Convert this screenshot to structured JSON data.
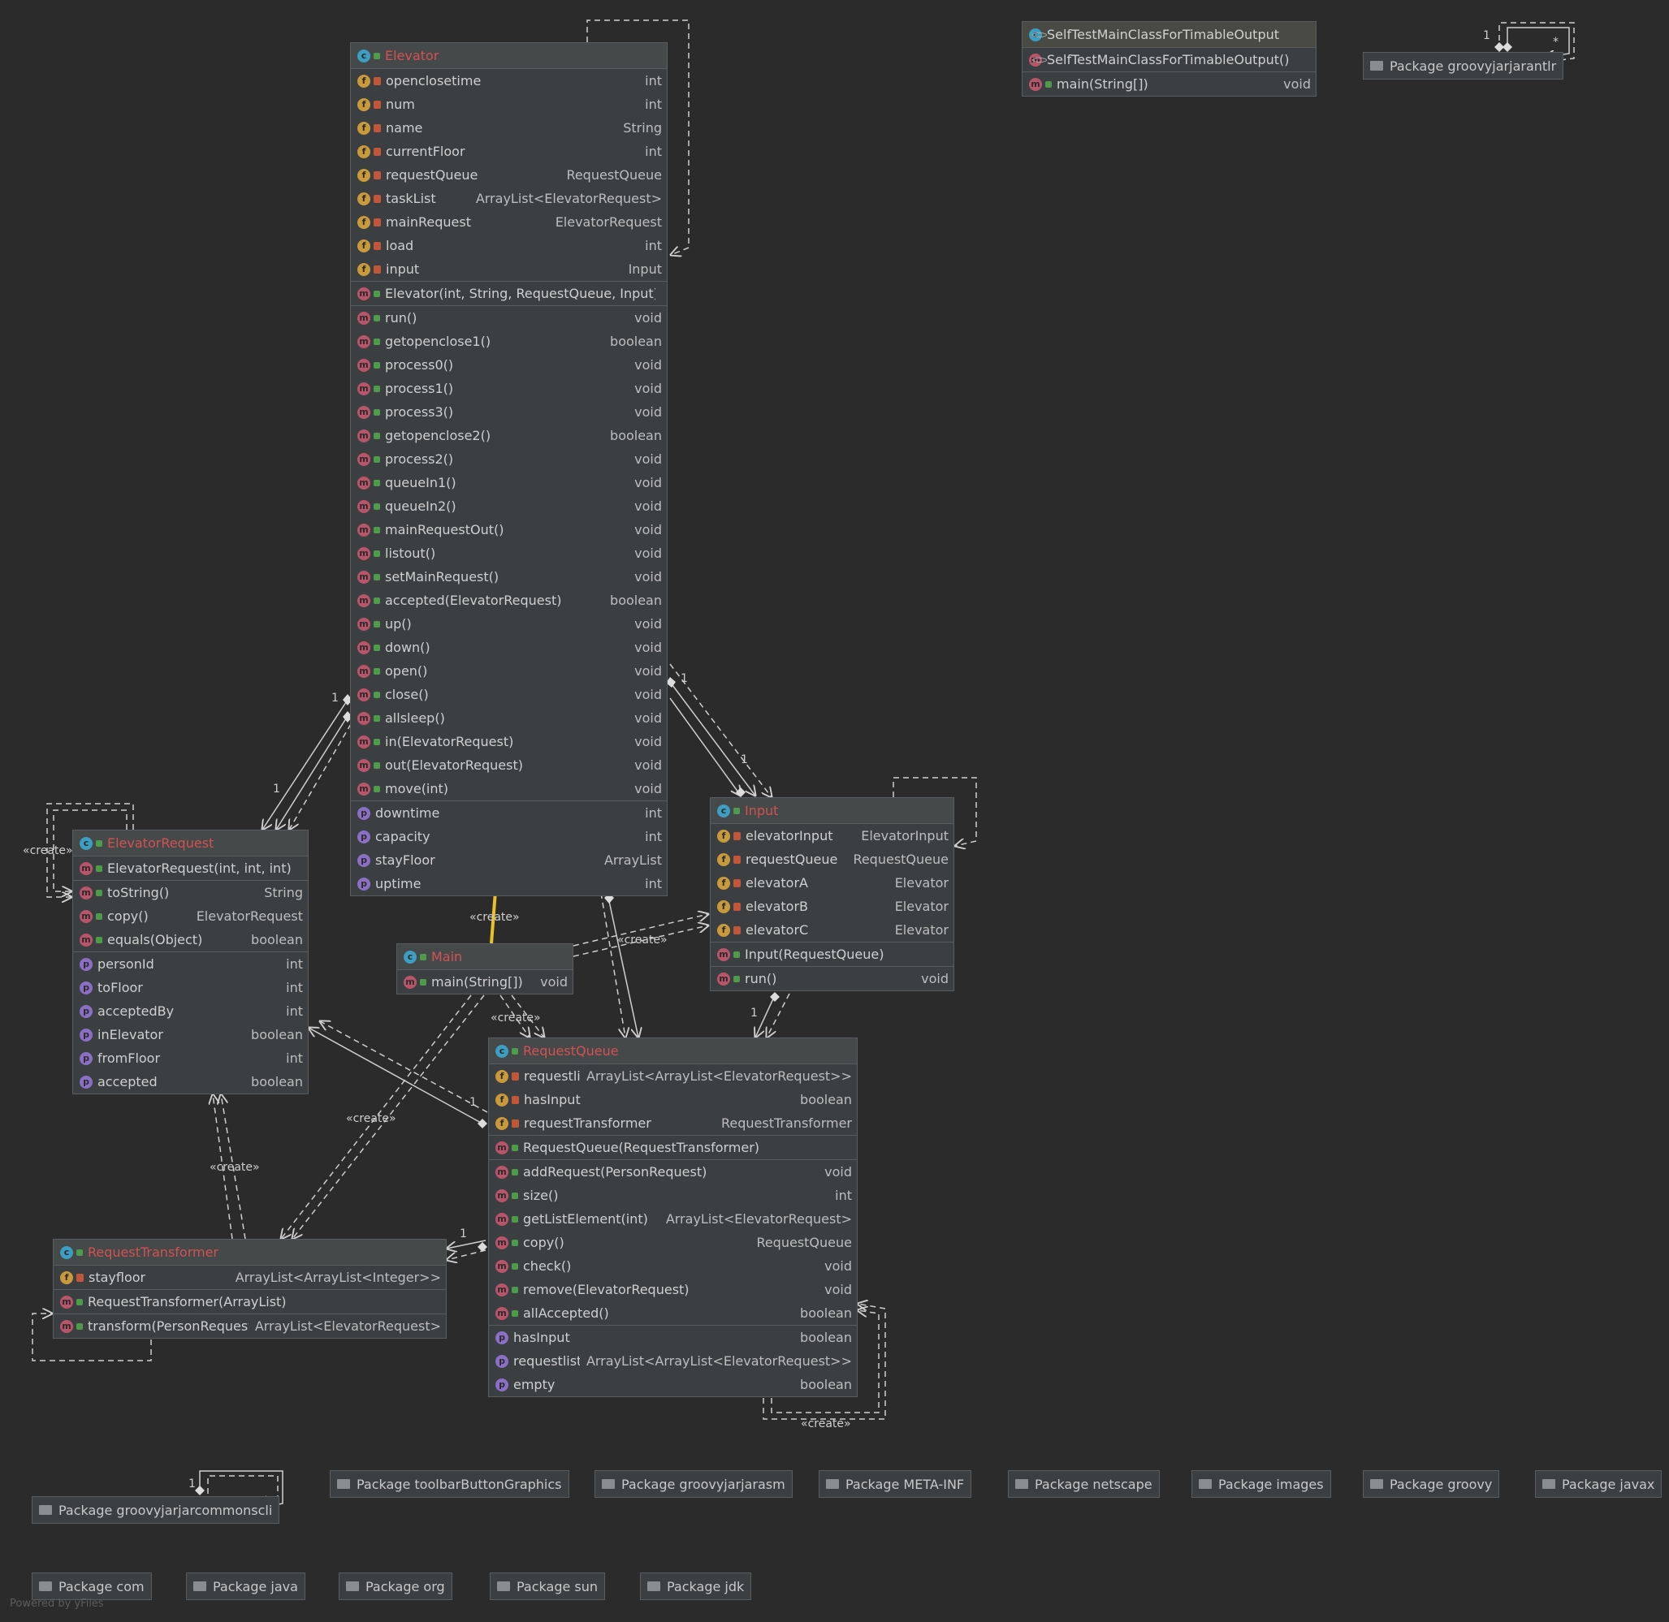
{
  "classes": {
    "elevator": {
      "name": "Elevator",
      "fields": [
        {
          "name": "openclosetime",
          "type": "int"
        },
        {
          "name": "num",
          "type": "int"
        },
        {
          "name": "name",
          "type": "String"
        },
        {
          "name": "currentFloor",
          "type": "int"
        },
        {
          "name": "requestQueue",
          "type": "RequestQueue"
        },
        {
          "name": "taskList",
          "type": "ArrayList<ElevatorRequest>"
        },
        {
          "name": "mainRequest",
          "type": "ElevatorRequest"
        },
        {
          "name": "load",
          "type": "int"
        },
        {
          "name": "input",
          "type": "Input"
        }
      ],
      "constructors": [
        {
          "name": "Elevator(int, String, RequestQueue, Input)",
          "type": ""
        }
      ],
      "methods": [
        {
          "name": "run()",
          "type": "void"
        },
        {
          "name": "getopenclose1()",
          "type": "boolean"
        },
        {
          "name": "process0()",
          "type": "void"
        },
        {
          "name": "process1()",
          "type": "void"
        },
        {
          "name": "process3()",
          "type": "void"
        },
        {
          "name": "getopenclose2()",
          "type": "boolean"
        },
        {
          "name": "process2()",
          "type": "void"
        },
        {
          "name": "queueIn1()",
          "type": "void"
        },
        {
          "name": "queueIn2()",
          "type": "void"
        },
        {
          "name": "mainRequestOut()",
          "type": "void"
        },
        {
          "name": "listout()",
          "type": "void"
        },
        {
          "name": "setMainRequest()",
          "type": "void"
        },
        {
          "name": "accepted(ElevatorRequest)",
          "type": "boolean"
        },
        {
          "name": "up()",
          "type": "void"
        },
        {
          "name": "down()",
          "type": "void"
        },
        {
          "name": "open()",
          "type": "void"
        },
        {
          "name": "close()",
          "type": "void"
        },
        {
          "name": "allsleep()",
          "type": "void"
        },
        {
          "name": "in(ElevatorRequest)",
          "type": "void"
        },
        {
          "name": "out(ElevatorRequest)",
          "type": "void"
        },
        {
          "name": "move(int)",
          "type": "void"
        }
      ],
      "properties": [
        {
          "name": "downtime",
          "type": "int"
        },
        {
          "name": "capacity",
          "type": "int"
        },
        {
          "name": "stayFloor",
          "type": "ArrayList"
        },
        {
          "name": "uptime",
          "type": "int"
        }
      ]
    },
    "selftest": {
      "name": "SelfTestMainClassForTimableOutput",
      "constructors": [
        {
          "name": "SelfTestMainClassForTimableOutput()",
          "type": ""
        }
      ],
      "methods": [
        {
          "name": "main(String[])",
          "type": "void"
        }
      ]
    },
    "elevatorRequest": {
      "name": "ElevatorRequest",
      "constructors": [
        {
          "name": "ElevatorRequest(int, int, int)",
          "type": ""
        }
      ],
      "methods": [
        {
          "name": "toString()",
          "type": "String"
        },
        {
          "name": "copy()",
          "type": "ElevatorRequest"
        },
        {
          "name": "equals(Object)",
          "type": "boolean"
        }
      ],
      "properties": [
        {
          "name": "personId",
          "type": "int"
        },
        {
          "name": "toFloor",
          "type": "int"
        },
        {
          "name": "acceptedBy",
          "type": "int"
        },
        {
          "name": "inElevator",
          "type": "boolean"
        },
        {
          "name": "fromFloor",
          "type": "int"
        },
        {
          "name": "accepted",
          "type": "boolean"
        }
      ]
    },
    "input": {
      "name": "Input",
      "fields": [
        {
          "name": "elevatorInput",
          "type": "ElevatorInput"
        },
        {
          "name": "requestQueue",
          "type": "RequestQueue"
        },
        {
          "name": "elevatorA",
          "type": "Elevator"
        },
        {
          "name": "elevatorB",
          "type": "Elevator"
        },
        {
          "name": "elevatorC",
          "type": "Elevator"
        }
      ],
      "constructors": [
        {
          "name": "Input(RequestQueue)",
          "type": ""
        }
      ],
      "methods": [
        {
          "name": "run()",
          "type": "void"
        }
      ]
    },
    "main": {
      "name": "Main",
      "methods": [
        {
          "name": "main(String[])",
          "type": "void"
        }
      ]
    },
    "requestQueue": {
      "name": "RequestQueue",
      "fields": [
        {
          "name": "requestlist",
          "type": "ArrayList<ArrayList<ElevatorRequest>>"
        },
        {
          "name": "hasInput",
          "type": "boolean"
        },
        {
          "name": "requestTransformer",
          "type": "RequestTransformer"
        }
      ],
      "constructors": [
        {
          "name": "RequestQueue(RequestTransformer)",
          "type": ""
        }
      ],
      "methods": [
        {
          "name": "addRequest(PersonRequest)",
          "type": "void"
        },
        {
          "name": "size()",
          "type": "int"
        },
        {
          "name": "getListElement(int)",
          "type": "ArrayList<ElevatorRequest>"
        },
        {
          "name": "copy()",
          "type": "RequestQueue"
        },
        {
          "name": "check()",
          "type": "void"
        },
        {
          "name": "remove(ElevatorRequest)",
          "type": "void"
        },
        {
          "name": "allAccepted()",
          "type": "boolean"
        }
      ],
      "properties": [
        {
          "name": "hasInput",
          "type": "boolean"
        },
        {
          "name": "requestlist",
          "type": "ArrayList<ArrayList<ElevatorRequest>>"
        },
        {
          "name": "empty",
          "type": "boolean"
        }
      ]
    },
    "requestTransformer": {
      "name": "RequestTransformer",
      "fields": [
        {
          "name": "stayfloor",
          "type": "ArrayList<ArrayList<Integer>>"
        }
      ],
      "constructors": [
        {
          "name": "RequestTransformer(ArrayList)",
          "type": ""
        }
      ],
      "methods": [
        {
          "name": "transform(PersonRequest)",
          "type": "ArrayList<ElevatorRequest>"
        }
      ]
    }
  },
  "packages": {
    "groovyjarjarantlr": "Package groovyjarjarantlr",
    "groovyjarjarcommonscli": "Package groovyjarjarcommonscli",
    "toolbarButtonGraphics": "Package toolbarButtonGraphics",
    "groovyjarjarasm": "Package groovyjarjarasm",
    "metainf": "Package META-INF",
    "netscape": "Package netscape",
    "images": "Package images",
    "groovy": "Package groovy",
    "javax": "Package javax",
    "com": "Package com",
    "java": "Package java",
    "org": "Package org",
    "sun": "Package sun",
    "jdk": "Package jdk"
  },
  "edge_labels": {
    "create": "«create»",
    "one": "1",
    "many": "*"
  },
  "icons": {
    "field": "f",
    "method": "m",
    "property": "p",
    "class": "c",
    "field_color": "#c99a3b",
    "method_color": "#b9556b",
    "property_color": "#8a6fc4",
    "class_color": "#3e9ec2",
    "highlight_edge_color": "#e8c02a"
  },
  "footer": "Powered by yFiles"
}
